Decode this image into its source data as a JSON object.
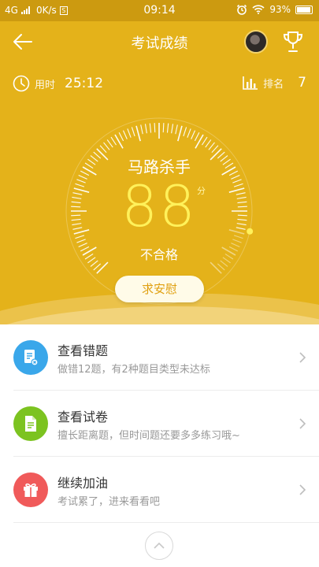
{
  "status_bar": {
    "network": "4G",
    "speed": "0K/s",
    "s_icon": "S",
    "time": "09:14",
    "battery": "93%"
  },
  "header": {
    "title": "考试成绩",
    "back_icon": "arrow-left-icon",
    "trophy_icon": "trophy-icon"
  },
  "stats": {
    "time_label": "用时",
    "time_value": "25:12",
    "rank_label": "排名",
    "rank_value": "7"
  },
  "score_card": {
    "nickname": "马路杀手",
    "score": "88",
    "unit": "分",
    "result": "不合格",
    "gauge_fraction": 0.88
  },
  "comfort_button": "求安慰",
  "actions": [
    {
      "title": "查看错题",
      "subtitle": "做错12题，有2种题目类型未达标",
      "icon": "wrong-questions-icon",
      "color": "#3aa7ea"
    },
    {
      "title": "查看试卷",
      "subtitle": "擅长距离题，但时间题还要多多练习哦~",
      "icon": "test-paper-icon",
      "color": "#7cc320"
    },
    {
      "title": "继续加油",
      "subtitle": "考试累了，进来看看吧",
      "icon": "gift-icon",
      "color": "#f05a5a"
    }
  ],
  "colors": {
    "hero": "#e4b21a",
    "score": "#fff15a",
    "comfort_text": "#e0a010"
  }
}
